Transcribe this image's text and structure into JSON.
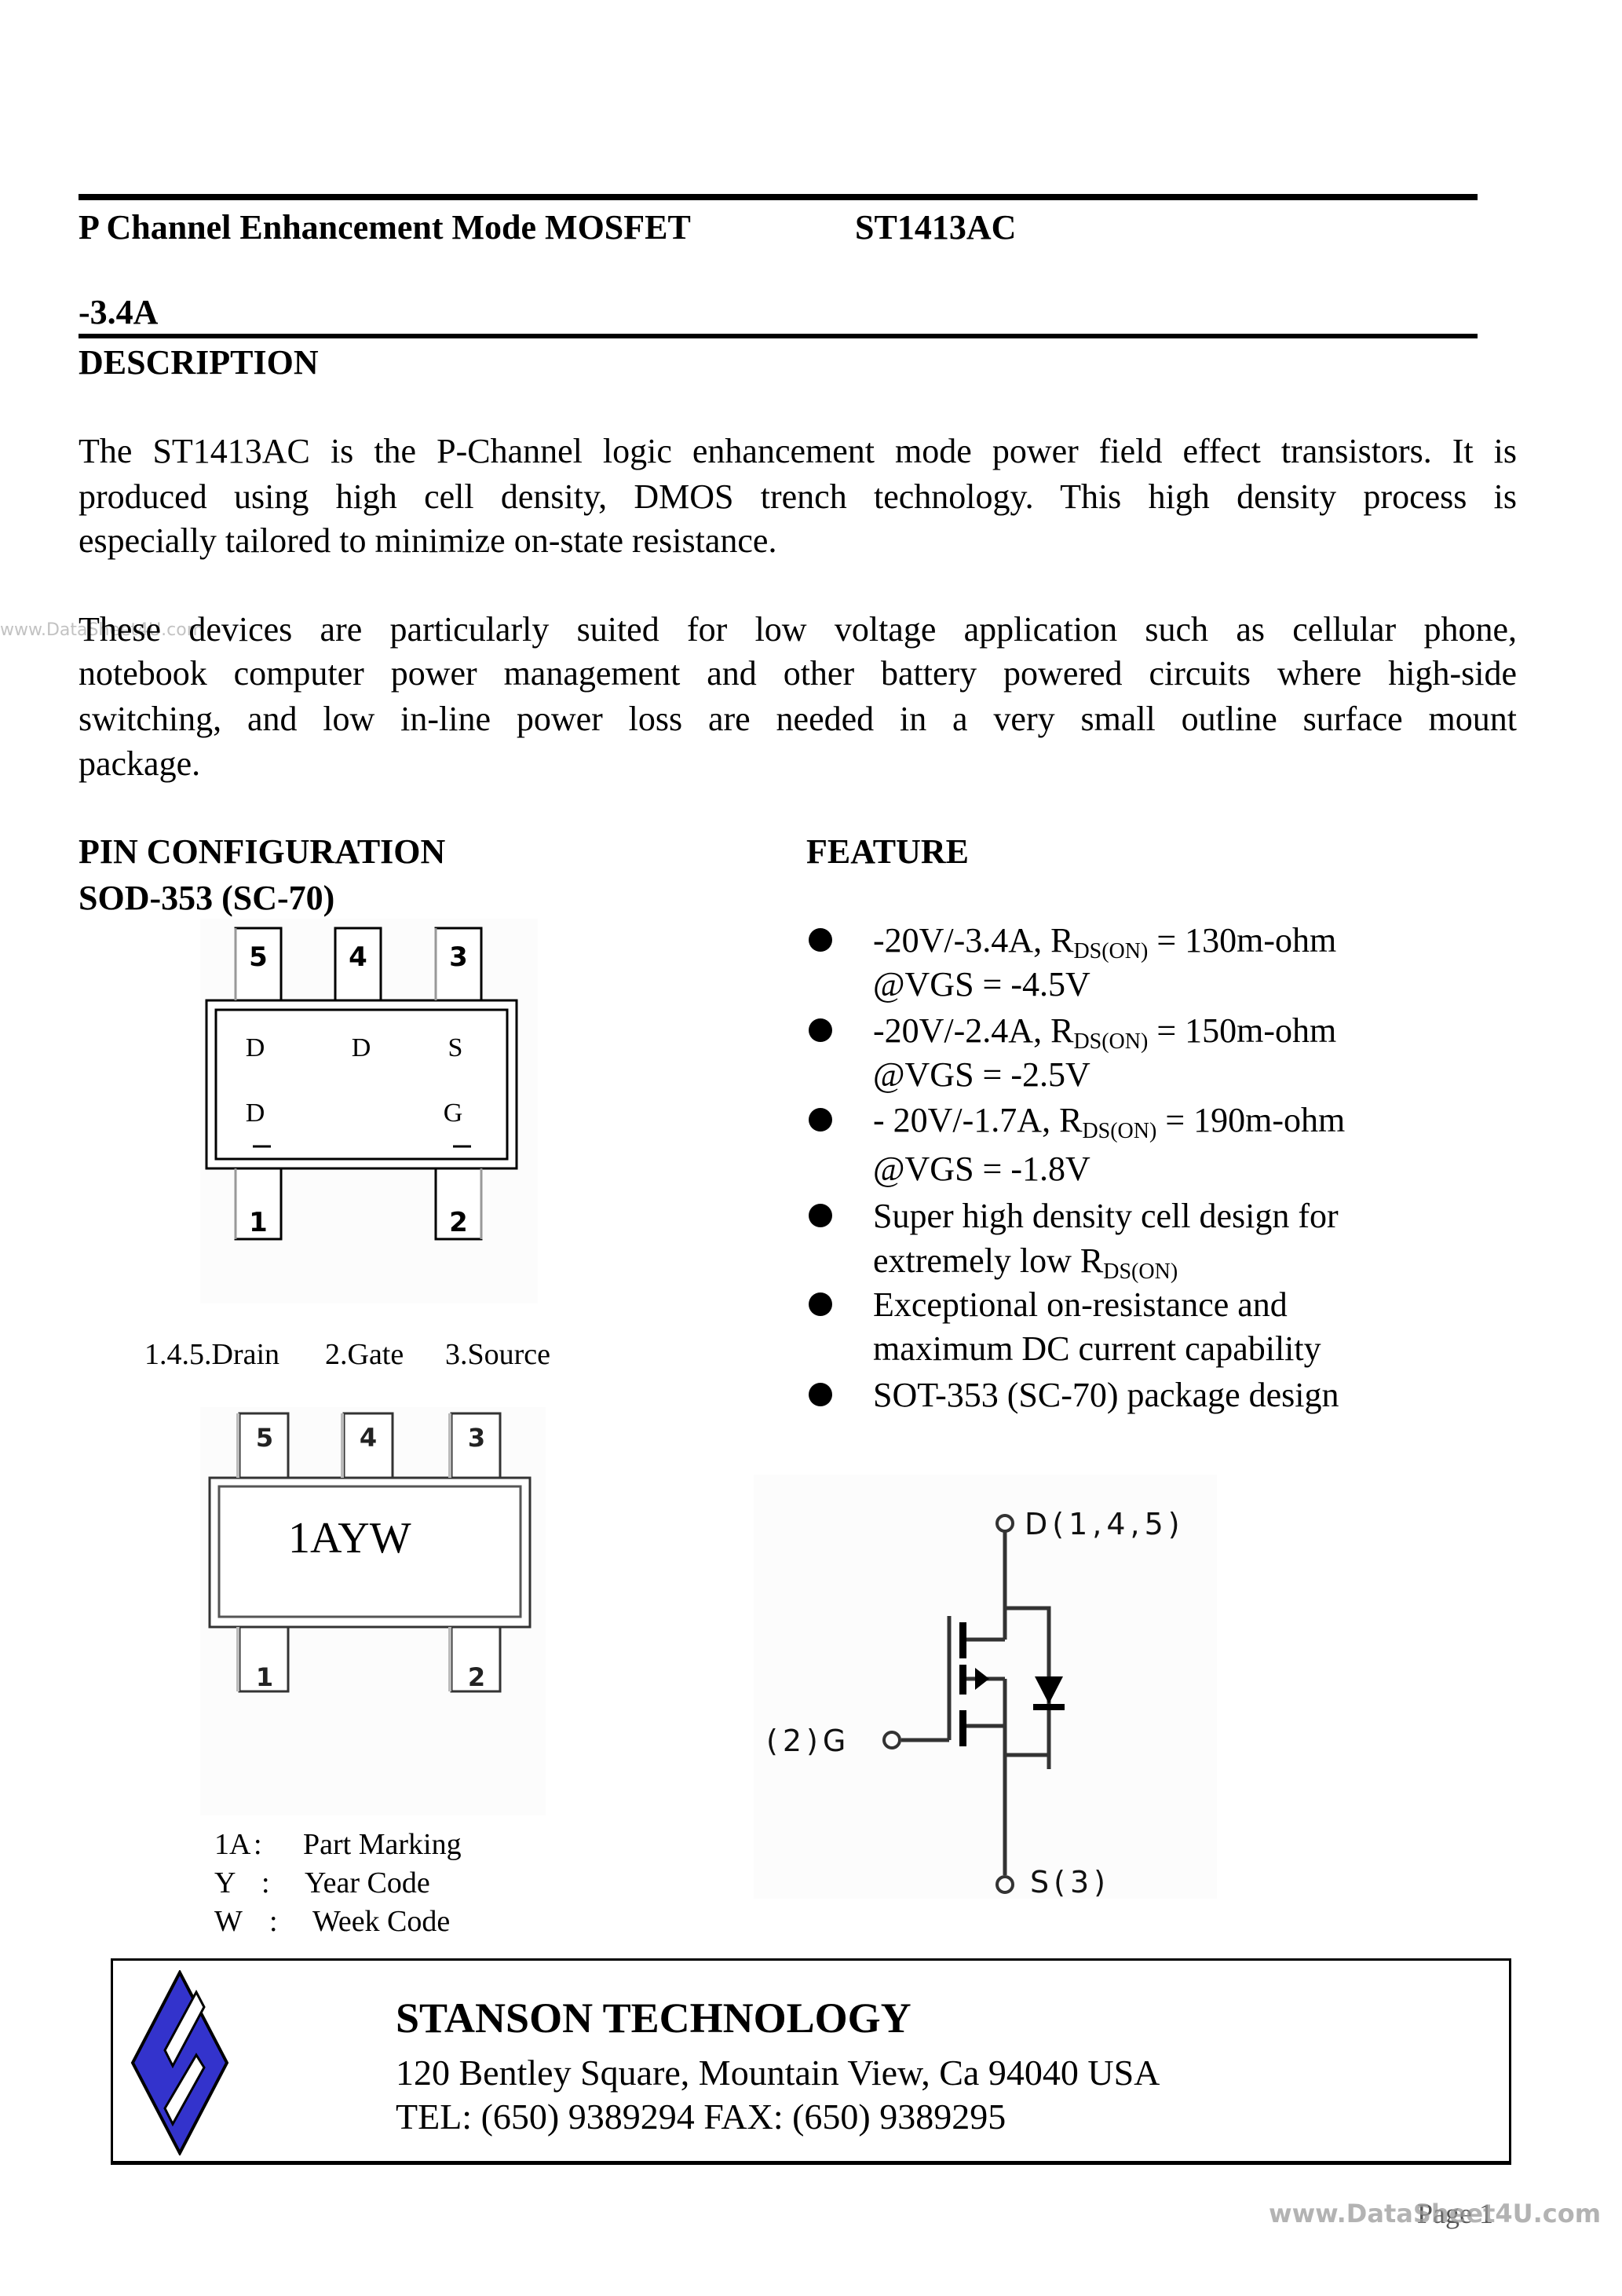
{
  "header": {
    "title": "P Channel Enhancement Mode MOSFET",
    "part_number": "ST1413AC",
    "current_rating": "-3.4A"
  },
  "description": {
    "heading": "DESCRIPTION",
    "paragraph1_lines": [
      "The ST1413AC is the P-Channel logic enhancement mode power field effect transistors. It is",
      "produced using high cell density, DMOS trench technology. This high density process is",
      "especially tailored to minimize on-state resistance."
    ],
    "paragraph2_lines": [
      "These devices are particularly suited for low voltage application such as cellular phone,",
      "notebook computer power management and other battery powered circuits where high-side",
      "switching, and low in-line power loss are needed in a very small outline surface mount",
      "package."
    ]
  },
  "pin_configuration": {
    "heading": "PIN CONFIGURATION",
    "package": "SOD-353 (SC-70)",
    "diagram1": {
      "top_pins": [
        "5",
        "4",
        "3"
      ],
      "bottom_pins": [
        "1",
        "2"
      ],
      "body_top_labels": [
        "D",
        "D",
        "S"
      ],
      "body_bottom_labels": [
        "D",
        "G"
      ],
      "caption": [
        "1.4.5.Drain",
        "2.Gate",
        "3.Source"
      ]
    },
    "diagram2": {
      "top_pins": [
        "5",
        "4",
        "3"
      ],
      "bottom_pins": [
        "1",
        "2"
      ],
      "marking": "1AYW"
    },
    "legend": [
      {
        "code": "1A",
        "sep": ":",
        "meaning": "Part Marking"
      },
      {
        "code": "Y",
        "sep": ":",
        "meaning": "Year Code"
      },
      {
        "code": "W",
        "sep": ":",
        "meaning": "Week Code"
      }
    ]
  },
  "features": {
    "heading": "FEATURE",
    "items": [
      {
        "line1_pre": "-20V/-3.4A, R",
        "sub": "DS(ON)",
        "line1_post": " = 130m-ohm",
        "line2": "@VGS = -4.5V"
      },
      {
        "line1_pre": "-20V/-2.4A, R",
        "sub": "DS(ON)",
        "line1_post": " = 150m-ohm",
        "line2": "@VGS = -2.5V"
      },
      {
        "line1_pre": "- 20V/-1.7A, R",
        "sub": "DS(ON)",
        "line1_post": " = 190m-ohm",
        "line2": "@VGS = -1.8V"
      },
      {
        "line1": "Super high density cell design for",
        "line2_pre": "extremely low R",
        "sub": "DS(ON)"
      },
      {
        "line1": "Exceptional on-resistance and",
        "line2": "maximum DC current capability"
      },
      {
        "line1": "SOT-353 (SC-70) package design"
      }
    ]
  },
  "schematic": {
    "drain_label": "D(1,4,5)",
    "gate_label": "(2)G",
    "source_label": "S(3)"
  },
  "company": {
    "name": "STANSON TECHNOLOGY",
    "address": "120 Bentley Square, Mountain View, Ca 94040  USA",
    "contact": "TEL: (650) 9389294   FAX: (650) 9389295",
    "logo_color": "#3333CC"
  },
  "footer": {
    "page": "Page 1",
    "watermark": "www.DataSheet4U.com"
  }
}
